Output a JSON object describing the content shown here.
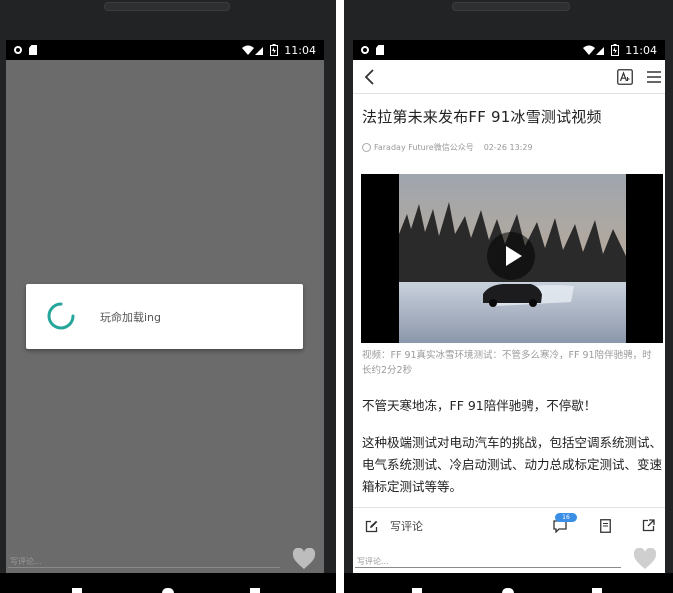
{
  "status_bar": {
    "time": "11:04"
  },
  "left_screen": {
    "loading_dialog": {
      "text": "玩命加载ing"
    },
    "comment_placeholder": "写评论..."
  },
  "right_screen": {
    "article": {
      "title": "法拉第未来发布FF 91冰雪测试视频",
      "source": "Faraday Future微信公众号",
      "date": "02-26 13:29",
      "video_caption": "视频：FF 91真实冰雪环境测试：不管多么寒冷，FF 91陪伴驰骋，时长约2分2秒",
      "paragraph_1": "不管天寒地冻，FF 91陪伴驰骋，不停歇！",
      "paragraph_2": "这种极端测试对电动汽车的挑战，包括空调系统测试、电气系统测试、冷启动测试、动力总成标定测试、变速箱标定测试等等。"
    },
    "action_bar": {
      "write_comment_label": "写评论",
      "comment_count": "16"
    },
    "comment_placeholder": "写评论..."
  },
  "icons": {
    "back": "back-arrow-icon",
    "font": "font-size-icon",
    "menu": "menu-icon",
    "play": "play-icon",
    "write": "edit-icon",
    "comment": "comment-icon",
    "bookmark": "bookmark-icon",
    "share": "share-icon",
    "heart": "heart-icon"
  },
  "colors": {
    "spinner": "#26a69a",
    "badge": "#3a8ee6",
    "heart": "#cfcfcf"
  }
}
